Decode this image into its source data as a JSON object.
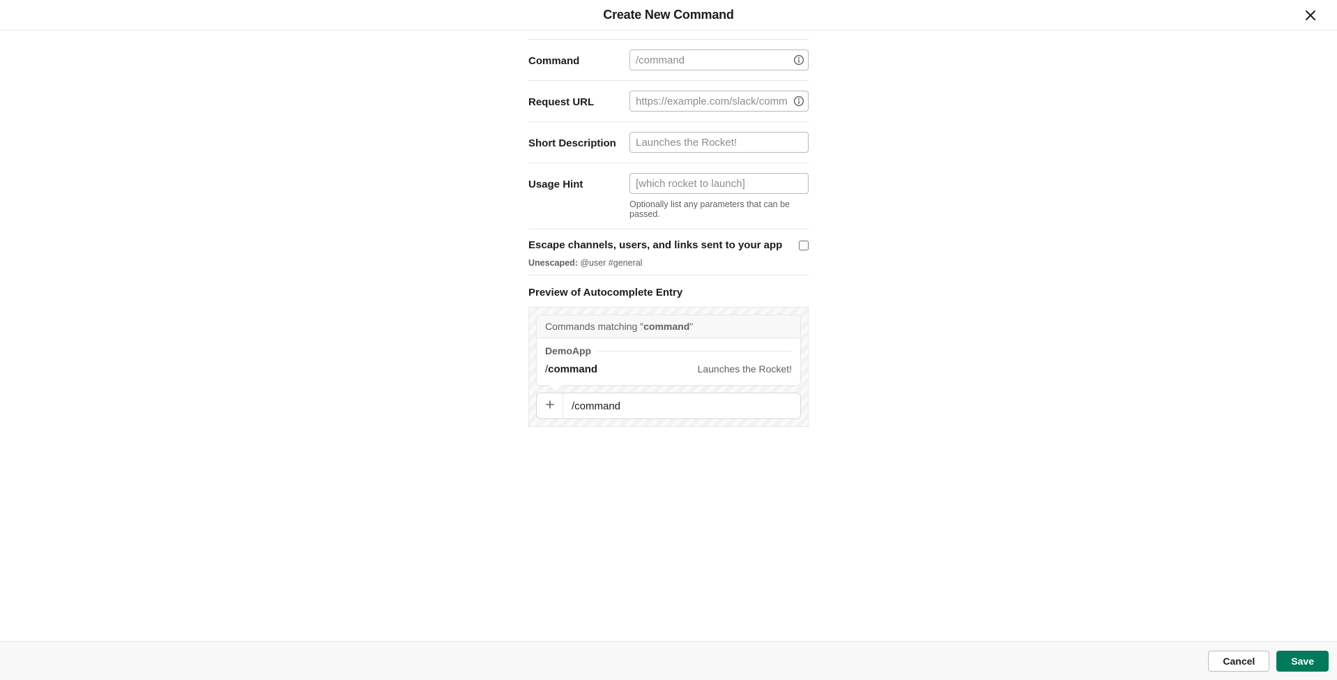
{
  "header": {
    "title": "Create New Command"
  },
  "fields": {
    "command": {
      "label": "Command",
      "placeholder": "/command",
      "value": ""
    },
    "request_url": {
      "label": "Request URL",
      "placeholder": "https://example.com/slack/command",
      "value": ""
    },
    "short_desc": {
      "label": "Short Description",
      "placeholder": "Launches the Rocket!",
      "value": ""
    },
    "usage_hint": {
      "label": "Usage Hint",
      "placeholder": "[which rocket to launch]",
      "value": "",
      "helper": "Optionally list any parameters that can be passed."
    }
  },
  "escape": {
    "label": "Escape channels, users, and links sent to your app",
    "sub_bold": "Unescaped:",
    "sub_rest": " @user #general",
    "checked": false
  },
  "preview": {
    "title": "Preview of Autocomplete Entry",
    "matching_prefix": "Commands matching \"",
    "matching_term": "command",
    "matching_suffix": "\"",
    "app_name": "DemoApp",
    "command_slash": "/",
    "command_text": "command",
    "desc": "Launches the Rocket!",
    "composer_text": "/command"
  },
  "footer": {
    "cancel": "Cancel",
    "save": "Save"
  }
}
